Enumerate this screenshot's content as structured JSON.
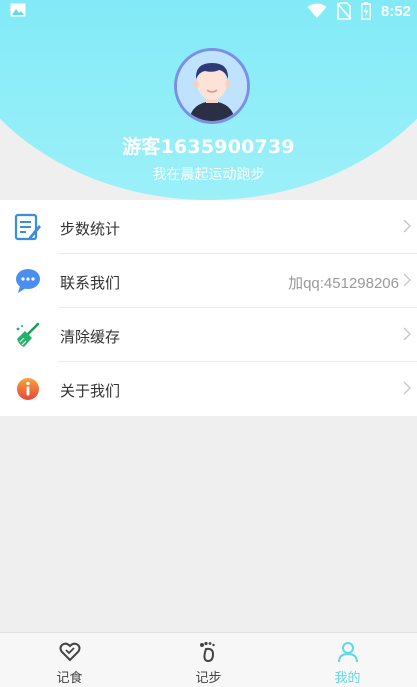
{
  "status_bar": {
    "time": "8:52",
    "icons": [
      "image-icon",
      "wifi-icon",
      "no-sim-icon",
      "battery-icon"
    ]
  },
  "profile": {
    "username": "游客1635900739",
    "motto": "我在晨起运动跑步"
  },
  "menu": {
    "items": [
      {
        "label": "步数统计",
        "icon": "notepad-edit-icon",
        "extra": ""
      },
      {
        "label": "联系我们",
        "icon": "chat-bubble-icon",
        "extra": "加qq:451298206"
      },
      {
        "label": "清除缓存",
        "icon": "broom-icon",
        "extra": ""
      },
      {
        "label": "关于我们",
        "icon": "info-icon",
        "extra": ""
      }
    ]
  },
  "tabbar": {
    "tabs": [
      {
        "label": "记食",
        "icon": "heart-icon",
        "active": false
      },
      {
        "label": "记步",
        "icon": "footprint-icon",
        "active": false
      },
      {
        "label": "我的",
        "icon": "person-icon",
        "active": true
      }
    ]
  },
  "colors": {
    "accent": "#5fd9e8",
    "header_gradient_top": "#5fe0ee",
    "header_gradient_bottom": "#9cf0f8"
  }
}
